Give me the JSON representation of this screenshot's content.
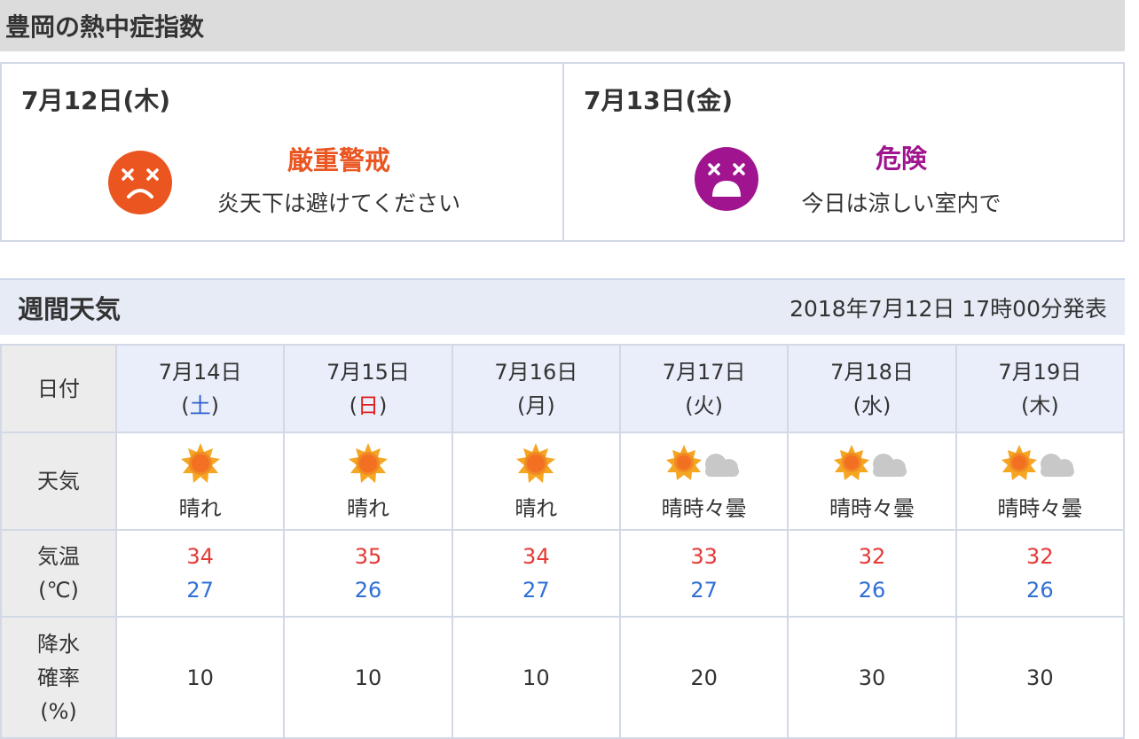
{
  "heat_index": {
    "title": "豊岡の熱中症指数",
    "days": [
      {
        "date": "7月12日(木)",
        "level": "厳重警戒",
        "advice": "炎天下は避けてください",
        "color": "#ea5520",
        "face": "worried-face-icon"
      },
      {
        "date": "7月13日(金)",
        "level": "危険",
        "advice": "今日は涼しい室内で",
        "color": "#a0158f",
        "face": "distressed-face-icon"
      }
    ]
  },
  "weekly": {
    "title": "週間天気",
    "issued": "2018年7月12日 17時00分発表",
    "row_labels": {
      "date": "日付",
      "weather": "天気",
      "temp_line1": "気温",
      "temp_line2": "(℃)",
      "rain_line1": "降水",
      "rain_line2": "確率",
      "rain_line3": "(%)"
    },
    "days": [
      {
        "date": "7月14日",
        "dow": "土",
        "weather": "晴れ",
        "icon": "sunny-icon",
        "high": "34",
        "low": "27",
        "rain": "10"
      },
      {
        "date": "7月15日",
        "dow": "日",
        "weather": "晴れ",
        "icon": "sunny-icon",
        "high": "35",
        "low": "26",
        "rain": "10"
      },
      {
        "date": "7月16日",
        "dow": "月",
        "weather": "晴れ",
        "icon": "sunny-icon",
        "high": "34",
        "low": "27",
        "rain": "10"
      },
      {
        "date": "7月17日",
        "dow": "火",
        "weather": "晴時々曇",
        "icon": "sun-cloud-icon",
        "high": "33",
        "low": "27",
        "rain": "20"
      },
      {
        "date": "7月18日",
        "dow": "水",
        "weather": "晴時々曇",
        "icon": "sun-cloud-icon",
        "high": "32",
        "low": "26",
        "rain": "30"
      },
      {
        "date": "7月19日",
        "dow": "木",
        "weather": "晴時々曇",
        "icon": "sun-cloud-icon",
        "high": "32",
        "low": "26",
        "rain": "30"
      }
    ],
    "colors": {
      "high": "#e53935",
      "low": "#2f6fd6",
      "saturday": "#3060d0",
      "sunday": "#e02020"
    }
  }
}
